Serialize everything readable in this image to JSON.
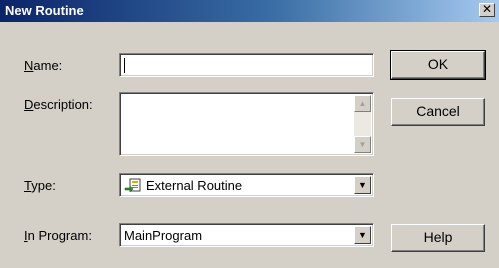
{
  "window": {
    "title": "New Routine",
    "close_symbol": "✕"
  },
  "form": {
    "name_label": "Name:",
    "name_value": "",
    "description_label": "Description:",
    "description_value": "",
    "type_label": "Type:",
    "type_value": "External Routine",
    "type_icon": "external-routine-icon",
    "program_label": "In Program:",
    "program_value": "MainProgram"
  },
  "buttons": {
    "ok": "OK",
    "cancel": "Cancel",
    "help": "Help"
  },
  "scrollbar": {
    "up_symbol": "▲",
    "down_symbol": "▼"
  },
  "combo": {
    "arrow_symbol": "▼"
  }
}
